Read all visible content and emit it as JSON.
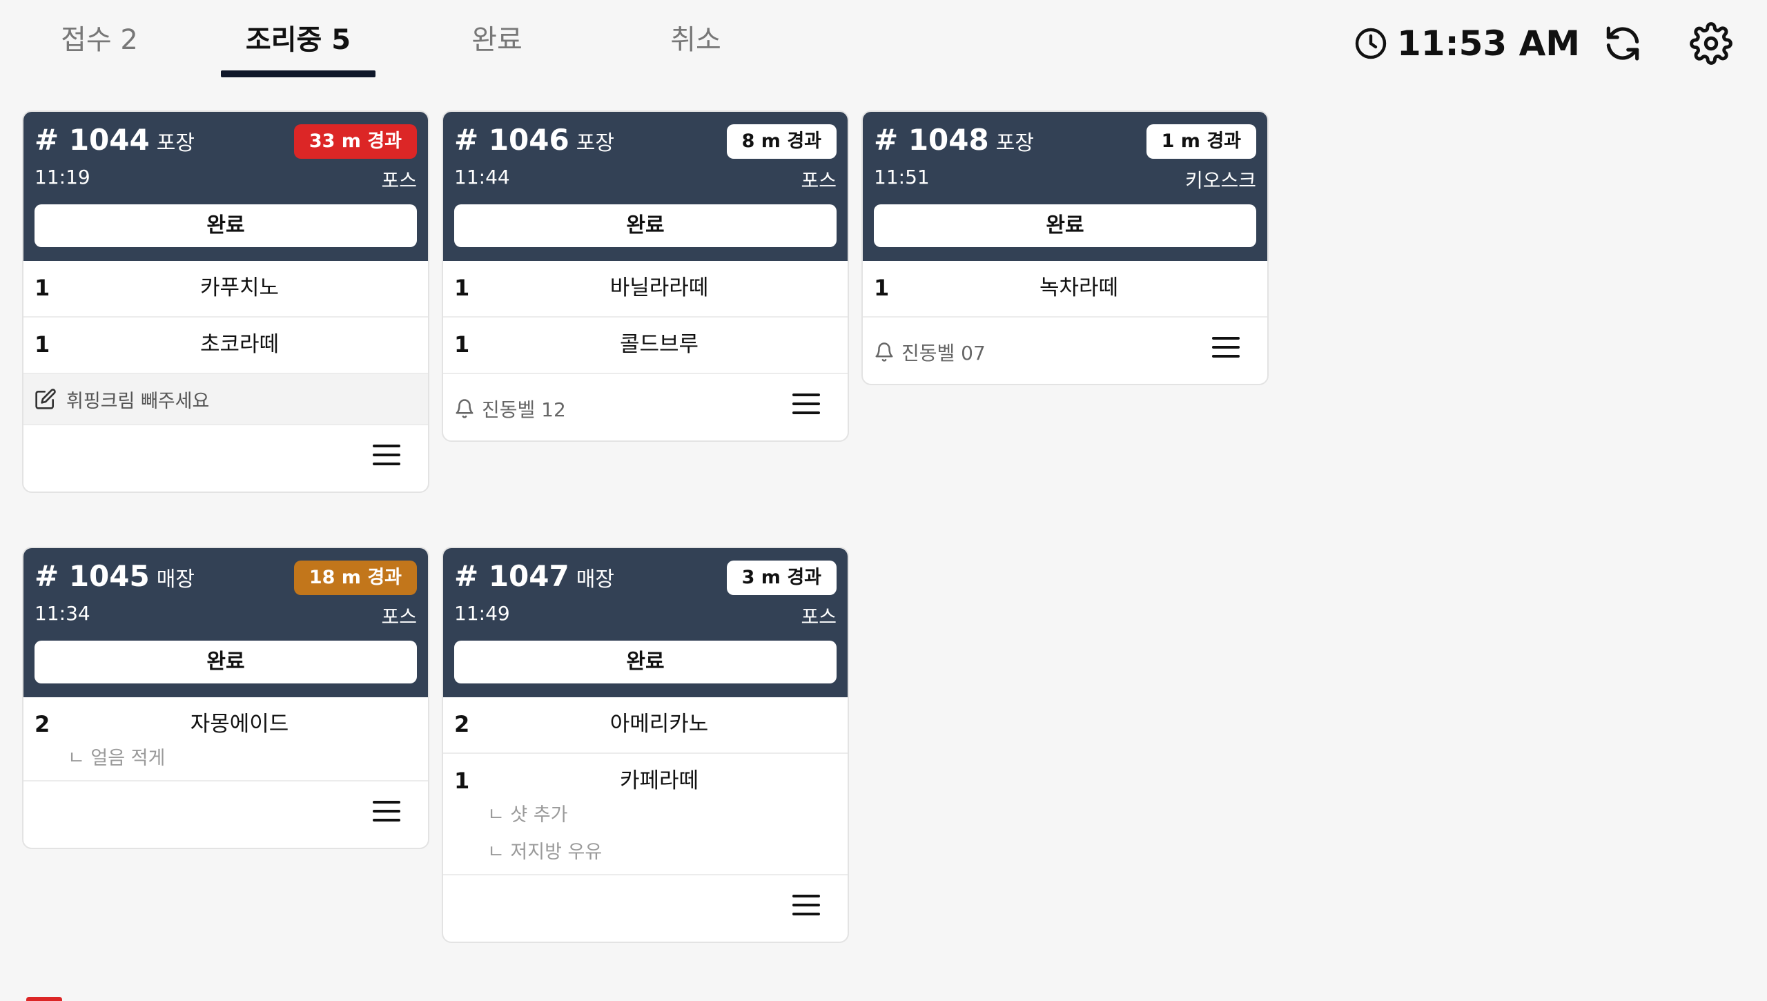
{
  "tabs": [
    {
      "label": "접수 2"
    },
    {
      "label": "조리중 5"
    },
    {
      "label": "완료"
    },
    {
      "label": "취소"
    }
  ],
  "clock": {
    "time": "11:53 AM"
  },
  "icons": {
    "clock": "clock-icon",
    "refresh": "refresh-icon",
    "settings": "gear-icon",
    "bell": "bell-icon",
    "memo": "edit-icon",
    "menu": "hamburger-menu-icon"
  },
  "colors": {
    "header": "#334155",
    "overdue": "#dc2626",
    "warning": "#c2761b",
    "active_tab": "#0f172a"
  },
  "orders": [
    {
      "number": "# 1044",
      "type": "포장",
      "elapsed": "33 m 경과",
      "time": "11:19",
      "source": "포스",
      "done_label": "완료",
      "items": [
        {
          "qty": "1",
          "name": "카푸치노"
        },
        {
          "qty": "1",
          "name": "초코라떼"
        }
      ],
      "memo": "휘핑크림 빼주세요"
    },
    {
      "number": "# 1046",
      "type": "포장",
      "elapsed": "8 m 경과",
      "time": "11:44",
      "source": "포스",
      "done_label": "완료",
      "items": [
        {
          "qty": "1",
          "name": "바닐라라떼"
        },
        {
          "qty": "1",
          "name": "콜드브루"
        }
      ],
      "bell": "진동벨 12"
    },
    {
      "number": "# 1048",
      "type": "포장",
      "elapsed": "1 m 경과",
      "time": "11:51",
      "source": "키오스크",
      "done_label": "완료",
      "items": [
        {
          "qty": "1",
          "name": "녹차라떼"
        }
      ],
      "bell": "진동벨 07"
    },
    {
      "number": "# 1045",
      "type": "매장",
      "elapsed": "18 m 경과",
      "time": "11:34",
      "source": "포스",
      "done_label": "완료",
      "items": [
        {
          "qty": "2",
          "name": "자몽에이드",
          "options": [
            "ㄴ 얼음 적게"
          ]
        }
      ]
    },
    {
      "number": "# 1047",
      "type": "매장",
      "elapsed": "3 m 경과",
      "time": "11:49",
      "source": "포스",
      "done_label": "완료",
      "items": [
        {
          "qty": "2",
          "name": "아메리카노"
        },
        {
          "qty": "1",
          "name": "카페라떼",
          "options": [
            "ㄴ 샷 추가",
            "ㄴ 저지방 우유"
          ]
        }
      ]
    }
  ]
}
